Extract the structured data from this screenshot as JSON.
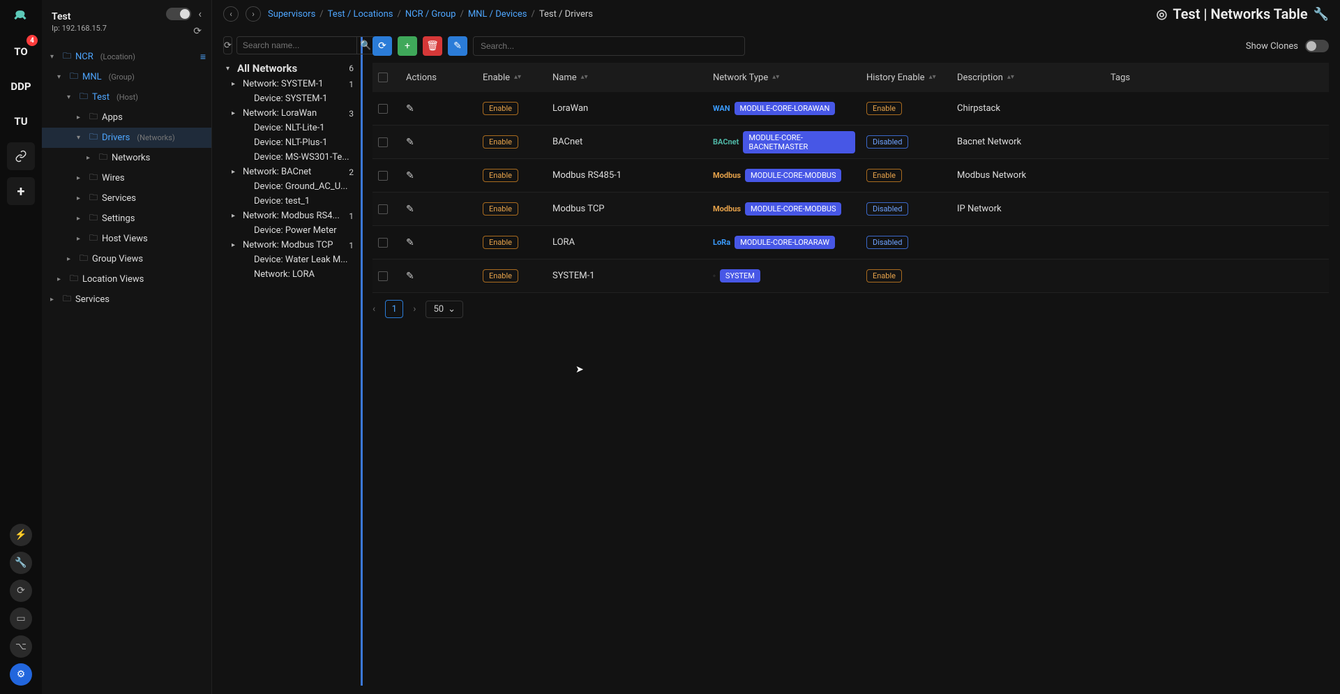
{
  "rail": {
    "badge": "4",
    "items": [
      "TO",
      "DDP",
      "TU"
    ],
    "link_icon": "link-icon",
    "plus_icon": "+"
  },
  "sidebar": {
    "title": "Test",
    "ip_label": "Ip:",
    "ip": "192.168.15.7",
    "tree": [
      {
        "chev": "v",
        "folder": true,
        "label": "NCR",
        "sub": "(Location)",
        "link": true,
        "indent": 0,
        "menu": true
      },
      {
        "chev": "v",
        "folder": true,
        "label": "MNL",
        "sub": "(Group)",
        "link": true,
        "indent": 1
      },
      {
        "chev": "v",
        "folder": true,
        "label": "Test",
        "sub": "(Host)",
        "link": true,
        "indent": 2
      },
      {
        "chev": ">",
        "folder": true,
        "label": "Apps",
        "indent": 3,
        "plain": true
      },
      {
        "chev": "v",
        "folder": true,
        "label": "Drivers",
        "sub": "(Networks)",
        "link": true,
        "indent": 3,
        "selected": true
      },
      {
        "chev": ">",
        "folder": true,
        "label": "Networks",
        "indent": 4,
        "plain": true
      },
      {
        "chev": ">",
        "folder": true,
        "label": "Wires",
        "indent": 3,
        "plain": true
      },
      {
        "chev": ">",
        "folder": true,
        "label": "Services",
        "indent": 3,
        "plain": true
      },
      {
        "chev": ">",
        "folder": true,
        "label": "Settings",
        "indent": 3,
        "plain": true
      },
      {
        "chev": ">",
        "folder": true,
        "label": "Host Views",
        "indent": 3,
        "plain": true
      },
      {
        "chev": ">",
        "folder": true,
        "label": "Group Views",
        "indent": 2,
        "plain": true
      },
      {
        "chev": ">",
        "folder": true,
        "label": "Location Views",
        "indent": 1,
        "plain": true
      },
      {
        "chev": ">",
        "folder": true,
        "label": "Services",
        "indent": 0,
        "plain": true
      }
    ]
  },
  "breadcrumb": {
    "items": [
      "Supervisors",
      "Test / Locations",
      "NCR / Group",
      "MNL / Devices",
      "Test / Drivers"
    ]
  },
  "page_title": "Test | Networks Table",
  "panel_left": {
    "search_placeholder": "Search name...",
    "title": "All Networks",
    "count": "6",
    "nodes": [
      {
        "exp": "▸",
        "name": "Network: SYSTEM-1",
        "count": "1"
      },
      {
        "exp": "",
        "name": "Device: SYSTEM-1"
      },
      {
        "exp": "▸",
        "name": "Network: LoraWan",
        "count": "3"
      },
      {
        "exp": "",
        "name": "Device: NLT-Lite-1"
      },
      {
        "exp": "",
        "name": "Device: NLT-Plus-1"
      },
      {
        "exp": "",
        "name": "Device: MS-WS301-Te..."
      },
      {
        "exp": "▸",
        "name": "Network: BACnet",
        "count": "2"
      },
      {
        "exp": "",
        "name": "Device: Ground_AC_U..."
      },
      {
        "exp": "",
        "name": "Device: test_1"
      },
      {
        "exp": "▸",
        "name": "Network: Modbus RS4...",
        "count": "1"
      },
      {
        "exp": "",
        "name": "Device: Power Meter"
      },
      {
        "exp": "▸",
        "name": "Network: Modbus TCP",
        "count": "1"
      },
      {
        "exp": "",
        "name": "Device: Water Leak M..."
      },
      {
        "exp": "",
        "name": "Network: LORA"
      }
    ]
  },
  "toolbar": {
    "search_placeholder": "Search...",
    "show_clones": "Show Clones"
  },
  "table": {
    "headers": [
      "Actions",
      "Enable",
      "Name",
      "Network Type",
      "History Enable",
      "Description",
      "Tags"
    ],
    "rows": [
      {
        "enable": "Enable",
        "name": "LoraWan",
        "logo": "WAN",
        "logo_color": "#3b9cff",
        "module": "MODULE-CORE-LORAWAN",
        "hist": "Enable",
        "desc": "Chirpstack"
      },
      {
        "enable": "Enable",
        "name": "BACnet",
        "logo": "BACnet",
        "logo_color": "#4fb7a6",
        "module": "MODULE-CORE-BACNETMASTER",
        "hist": "Disabled",
        "desc": "Bacnet Network"
      },
      {
        "enable": "Enable",
        "name": "Modbus RS485-1",
        "logo": "Modbus",
        "logo_color": "#e6a24a",
        "module": "MODULE-CORE-MODBUS",
        "hist": "Enable",
        "desc": "Modbus Network"
      },
      {
        "enable": "Enable",
        "name": "Modbus TCP",
        "logo": "Modbus",
        "logo_color": "#e6a24a",
        "module": "MODULE-CORE-MODBUS",
        "hist": "Disabled",
        "desc": "IP Network"
      },
      {
        "enable": "Enable",
        "name": "LORA",
        "logo": "LoRa",
        "logo_color": "#3b9cff",
        "module": "MODULE-CORE-LORARAW",
        "hist": "Disabled",
        "desc": ""
      },
      {
        "enable": "Enable",
        "name": "SYSTEM-1",
        "logo": "",
        "logo_color": "#888",
        "module": "SYSTEM",
        "hist": "Enable",
        "desc": ""
      }
    ]
  },
  "pager": {
    "page": "1",
    "size": "50"
  }
}
